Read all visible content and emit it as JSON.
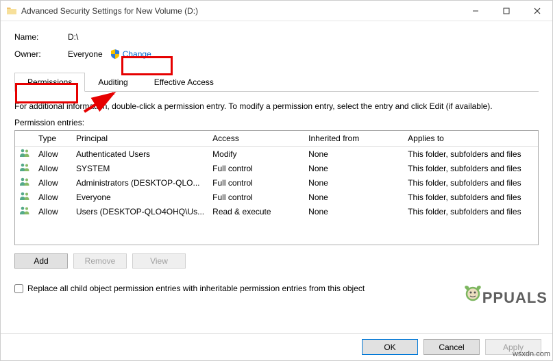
{
  "window": {
    "title": "Advanced Security Settings for New Volume (D:)"
  },
  "info": {
    "name_label": "Name:",
    "name_value": "D:\\",
    "owner_label": "Owner:",
    "owner_value": "Everyone",
    "change_label": "Change"
  },
  "tabs": {
    "permissions": "Permissions",
    "auditing": "Auditing",
    "effective": "Effective Access"
  },
  "tab_info": "For additional information, double-click a permission entry. To modify a permission entry, select the entry and click Edit (if available).",
  "entries_label": "Permission entries:",
  "columns": {
    "type": "Type",
    "principal": "Principal",
    "access": "Access",
    "inherited": "Inherited from",
    "applies": "Applies to"
  },
  "rows": [
    {
      "type": "Allow",
      "principal": "Authenticated Users",
      "access": "Modify",
      "inherited": "None",
      "applies": "This folder, subfolders and files"
    },
    {
      "type": "Allow",
      "principal": "SYSTEM",
      "access": "Full control",
      "inherited": "None",
      "applies": "This folder, subfolders and files"
    },
    {
      "type": "Allow",
      "principal": "Administrators (DESKTOP-QLO...",
      "access": "Full control",
      "inherited": "None",
      "applies": "This folder, subfolders and files"
    },
    {
      "type": "Allow",
      "principal": "Everyone",
      "access": "Full control",
      "inherited": "None",
      "applies": "This folder, subfolders and files"
    },
    {
      "type": "Allow",
      "principal": "Users (DESKTOP-QLO4OHQ\\Us...",
      "access": "Read & execute",
      "inherited": "None",
      "applies": "This folder, subfolders and files"
    }
  ],
  "buttons": {
    "add": "Add",
    "remove": "Remove",
    "view": "View"
  },
  "checkbox_label": "Replace all child object permission entries with inheritable permission entries from this object",
  "footer": {
    "ok": "OK",
    "cancel": "Cancel",
    "apply": "Apply"
  },
  "watermark": "PPUALS",
  "wsx": "wsxdn.com"
}
